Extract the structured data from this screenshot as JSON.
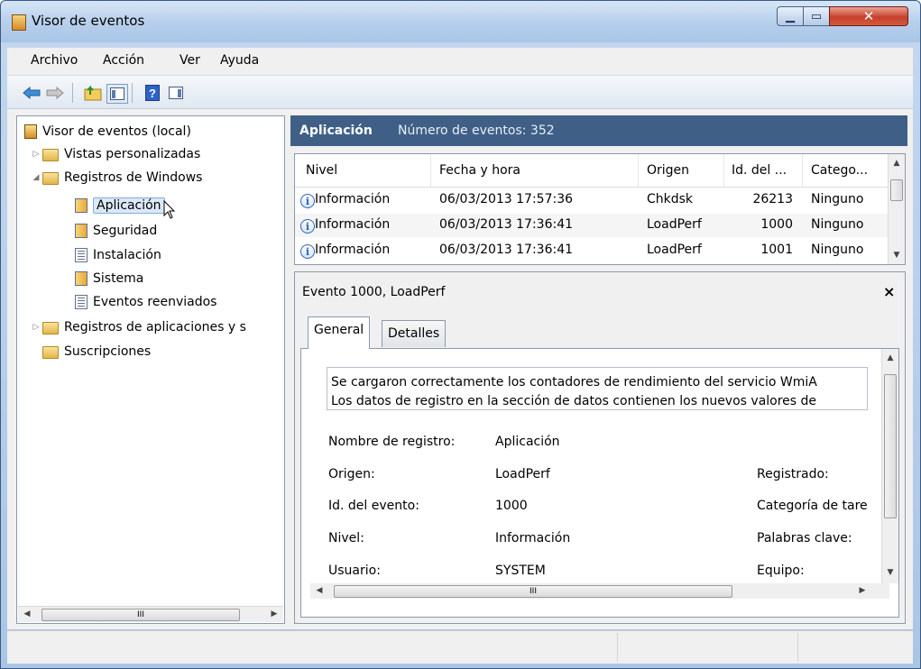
{
  "window": {
    "title": "Visor de eventos"
  },
  "menu": [
    "Archivo",
    "Acción",
    "Ver",
    "Ayuda"
  ],
  "tree": {
    "items": [
      {
        "label": "Visor de eventos (local)"
      },
      {
        "label": "Vistas personalizadas"
      },
      {
        "label": "Registros de Windows"
      },
      {
        "label": "Aplicación"
      },
      {
        "label": "Seguridad"
      },
      {
        "label": "Instalación"
      },
      {
        "label": "Sistema"
      },
      {
        "label": "Eventos reenviados"
      },
      {
        "label": "Registros de aplicaciones y s"
      },
      {
        "label": "Suscripciones"
      }
    ],
    "hscroll_mid": "III"
  },
  "log_header": {
    "title": "Aplicación",
    "count": "Número de eventos: 352"
  },
  "events": {
    "columns": [
      "Nivel",
      "Fecha y hora",
      "Origen",
      "Id. del ...",
      "Catego..."
    ],
    "rows": [
      {
        "level": "Información",
        "datetime": "06/03/2013 17:57:36",
        "source": "Chkdsk",
        "id": "26213",
        "category": "Ninguno"
      },
      {
        "level": "Información",
        "datetime": "06/03/2013 17:36:41",
        "source": "LoadPerf",
        "id": "1000",
        "category": "Ninguno"
      },
      {
        "level": "Información",
        "datetime": "06/03/2013 17:36:41",
        "source": "LoadPerf",
        "id": "1001",
        "category": "Ninguno"
      }
    ]
  },
  "detail": {
    "title": "Evento 1000, LoadPerf",
    "close": "×",
    "tabs": [
      "General",
      "Detalles"
    ],
    "description": [
      "Se cargaron correctamente los contadores de rendimiento del servicio WmiA",
      "Los datos de registro en la sección de datos contienen los nuevos valores de"
    ],
    "fields": [
      {
        "label": "Nombre de registro:",
        "value": "Aplicación",
        "right": ""
      },
      {
        "label": "Origen:",
        "value": "LoadPerf",
        "right": "Registrado:"
      },
      {
        "label": "Id. del evento:",
        "value": "1000",
        "right": "Categoría de tare"
      },
      {
        "label": "Nivel:",
        "value": "Información",
        "right": "Palabras clave:"
      },
      {
        "label": "Usuario:",
        "value": "SYSTEM",
        "right": "Equipo:"
      }
    ],
    "hscroll_mid": "III"
  }
}
